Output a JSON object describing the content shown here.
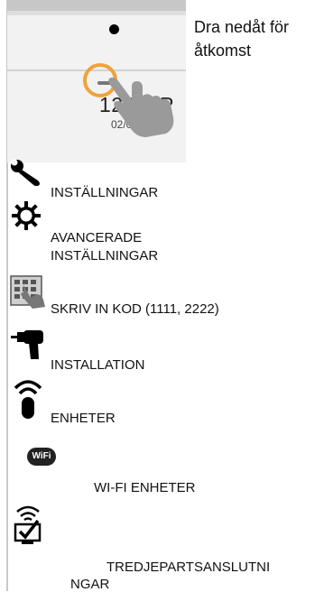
{
  "hint": {
    "line1": "Dra nedåt för",
    "line2": "åtkomst"
  },
  "panel": {
    "time": "12:55 P",
    "date": "02/01/18"
  },
  "menu": [
    {
      "icon": "wrench-icon",
      "label": "INSTÄLLNINGAR"
    },
    {
      "icon": "gear-icon",
      "label1": "AVANCERADE",
      "label2": "INSTÄLLNINGAR"
    },
    {
      "icon": "keypad-hand-icon",
      "label": "SKRIV IN KOD (1111, 2222)"
    },
    {
      "icon": "drill-icon",
      "label": "INSTALLATION"
    },
    {
      "icon": "wireless-sensor-icon",
      "label": "ENHETER"
    },
    {
      "icon": "wifi-badge-icon",
      "badge": "WiFi",
      "label": "WI-FI ENHETER"
    },
    {
      "icon": "wireless-checkbox-icon",
      "label1": "TREDJEPARTSANSLUTNI",
      "label2": "NGAR"
    }
  ],
  "colors": {
    "accent_ring": "#f1a23a",
    "hand": "#9a9a9a"
  }
}
